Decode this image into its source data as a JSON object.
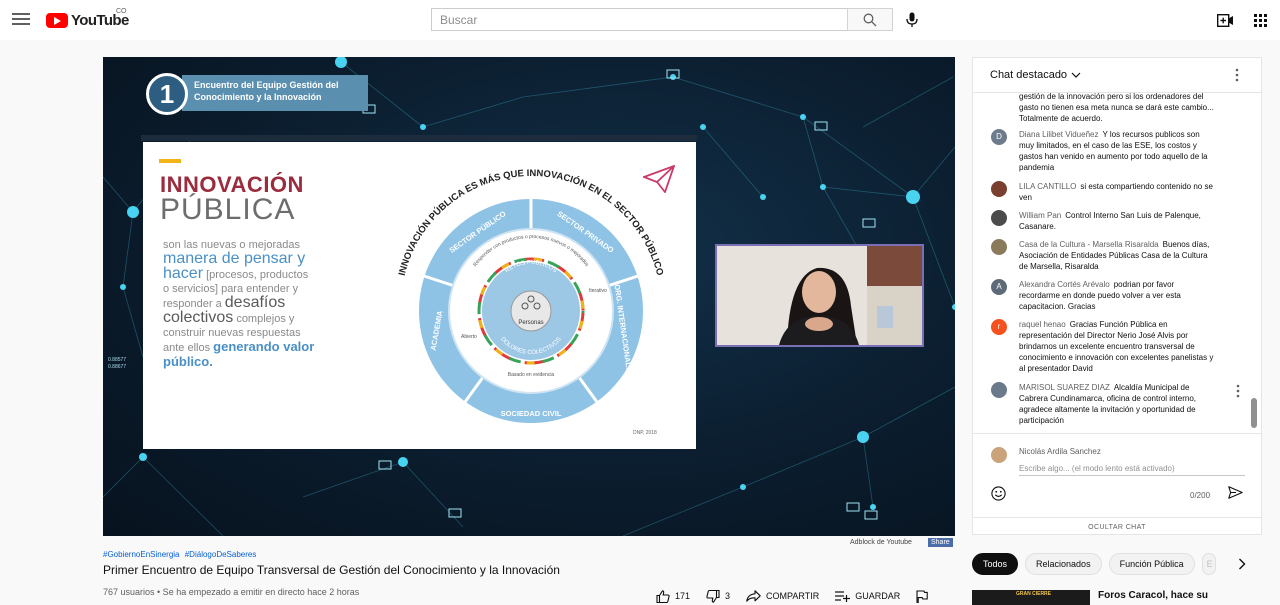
{
  "header": {
    "logo_text": "YouTube",
    "country": "CO",
    "search_placeholder": "Buscar",
    "icons": [
      "menu-icon",
      "search-icon",
      "mic-icon",
      "create-icon",
      "apps-icon"
    ]
  },
  "video": {
    "overlay": {
      "number": "1",
      "title": "Encuentro del Equipo Gestión del Conocimiento y la Innovación"
    },
    "slide": {
      "title_1": "INNOVACIÓN",
      "title_2": "PÚBLICA",
      "body_1": "son las nuevas o mejoradas",
      "body_2": "manera de pensar y",
      "body_3": "hacer",
      "body_4": "[procesos, productos",
      "body_5": "o servicios] para entender y",
      "body_6": "responder a",
      "body_7": "desafíos",
      "body_8": "colectivos",
      "body_9": "complejos y",
      "body_10": "construir nuevas respuestas",
      "body_11": "ante ellos",
      "body_12": "generando valor",
      "body_13": "público.",
      "source": "DNP, 2018",
      "diagram": {
        "arc_title": "INNOVACIÓN PÚBLICA ES MÁS QUE INNOVACIÓN EN EL SECTOR PÚBLICO",
        "sector_publico": "SECTOR PÚBLICO",
        "sector_privado": "SECTOR PRIVADO",
        "org_internacionales": "ORG. INTERNACIONALES",
        "sociedad_civil": "SOCIEDAD CIVIL",
        "academia": "ACADEMIA",
        "inner_arc": "Responder con productos o procesos nuevos o mejorados",
        "enfoques": "Enfoques de EXPERIMENTACIÓN",
        "retos": "RETOS PÚBLICOS",
        "dolores": "DOLORES COLECTIVOS",
        "center": "Personas",
        "iterativo": "Iterativo",
        "abierto": "Abierto",
        "evidencia": "Basado en evidencia"
      }
    },
    "adblock": "Adblock de Youtube",
    "share": "Share"
  },
  "info": {
    "hashtags": [
      "#GobiernoEnSinergia",
      "#DiálogoDeSaberes"
    ],
    "title": "Primer Encuentro de Equipo Transversal de Gestión del Conocimiento y la Innovación",
    "meta": "767 usuarios • Se ha empezado a emitir en directo hace 2 horas",
    "likes": "171",
    "dislikes": "3",
    "share_label": "COMPARTIR",
    "save_label": "GUARDAR"
  },
  "chat": {
    "header": "Chat destacado",
    "messages": [
      {
        "author": "",
        "text": "gestión de la innovación pero si los ordenadores del gasto no tienen esa meta nunca se dará este cambio... Totalmente de acuerdo.",
        "avatar": "",
        "color": "#ffffff"
      },
      {
        "author": "Diana Lilibet Vidueñez",
        "text": "Y los recursos publicos son muy limitados, en el caso de las ESE, los costos y gastos han venido en aumento por todo aquello de la pandemia",
        "avatar": "D",
        "color": "#6d7c8c"
      },
      {
        "author": "LILA CANTILLO",
        "text": "si esta compartiendo contenido no se ven",
        "avatar": "",
        "color": "#7a3f2e"
      },
      {
        "author": "William Pan",
        "text": "Control Interno San Luis de Palenque, Casanare.",
        "avatar": "",
        "color": "#4c4c4c"
      },
      {
        "author": "Casa de la Cultura - Marsella Risaralda",
        "text": "Buenos días, Asociación de Entidades Públicas Casa de la Cultura de Marsella, Risaralda",
        "avatar": "",
        "color": "#8a7a5a"
      },
      {
        "author": "Alexandra Cortés Arévalo",
        "text": "podrian por favor recordarme en donde puedo volver a ver esta capacitacion. Gracias",
        "avatar": "A",
        "color": "#5e6a77"
      },
      {
        "author": "raquel henao",
        "text": "Gracias Función Pública en representación del Director Nerio José Alvis por brindarnos un excelente encuentro transversal de conocimiento e innovación con excelentes panelistas y al presentador David",
        "avatar": "r",
        "color": "#f4511e"
      },
      {
        "author": "MARISOL SUAREZ DIAZ",
        "text": "Alcaldía Municipal de Cabrera Cundinamarca, oficina de control interno, agradece altamente la invitación y oportunidad de participación",
        "avatar": "",
        "color": "#6a7a8a"
      }
    ],
    "composer": {
      "name": "Nicolás Ardila Sanchez",
      "placeholder": "Escribe algo... (el modo lento está activado)",
      "counter": "0/200"
    },
    "hide_label": "OCULTAR CHAT"
  },
  "chips": [
    "Todos",
    "Relacionados",
    "Función Pública",
    "E"
  ],
  "recommendation": {
    "title": "Foros Caracol, hace su",
    "thumb_text": "GRAN CIERRE"
  }
}
